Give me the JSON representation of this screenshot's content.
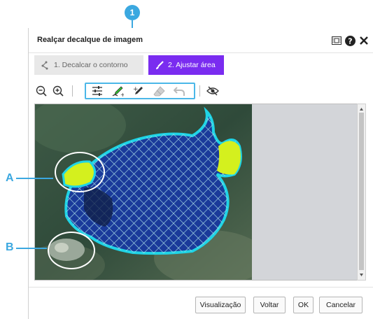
{
  "dialog": {
    "title": "Realçar decalque de imagem",
    "icons": [
      "film-icon",
      "help-icon",
      "close-icon"
    ]
  },
  "steps": [
    {
      "label": "1. Decalcar o contorno",
      "icon": "trace-icon",
      "active": false
    },
    {
      "label": "2. Ajustar área",
      "icon": "brush-icon",
      "active": true
    }
  ],
  "toolbar": {
    "tools": [
      "zoom-out-icon",
      "zoom-in-icon",
      "sliders-icon",
      "add-area-pen-icon",
      "remove-area-pen-icon",
      "eraser-icon",
      "undo-icon",
      "hide-preview-icon"
    ]
  },
  "buttons": {
    "preview": "Visualização",
    "back": "Voltar",
    "ok": "OK",
    "cancel": "Cancelar"
  },
  "callouts": {
    "one": "1",
    "a": "A",
    "b": "B"
  },
  "colors": {
    "accent": "#7a2cf0",
    "callout": "#3ba8e0",
    "mask_outline": "#1fd4e6",
    "mask_fill": "#d4f01e"
  }
}
